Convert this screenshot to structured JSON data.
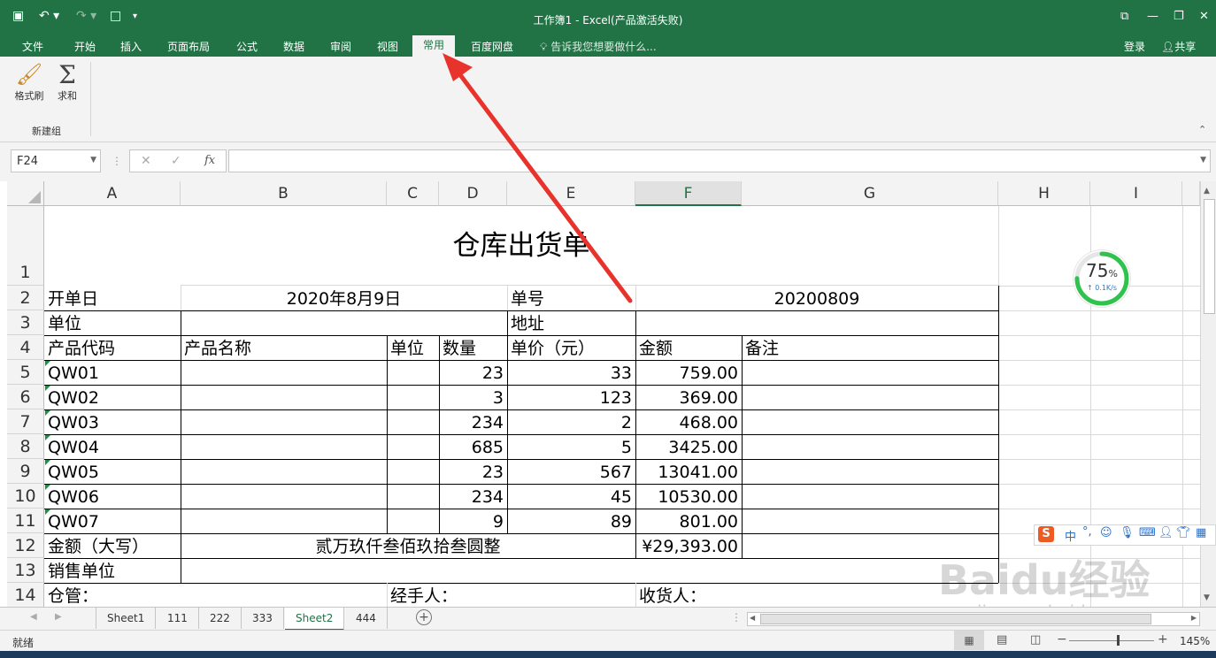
{
  "window": {
    "title": "工作簿1 - Excel(产品激活失败)"
  },
  "ribbon_tabs": [
    "文件",
    "开始",
    "插入",
    "页面布局",
    "公式",
    "数据",
    "审阅",
    "视图",
    "常用",
    "百度网盘"
  ],
  "tell_me": "告诉我您想要做什么...",
  "account": {
    "login": "登录",
    "share": "共享"
  },
  "ribbon_buttons": {
    "format_painter": "格式刷",
    "sum": "求和",
    "group": "新建组"
  },
  "formula": {
    "name_box": "F24",
    "fx": "fx",
    "value": ""
  },
  "columns": [
    "A",
    "B",
    "C",
    "D",
    "E",
    "F",
    "G",
    "H",
    "I"
  ],
  "rows": [
    "1",
    "2",
    "3",
    "4",
    "5",
    "6",
    "7",
    "8",
    "9",
    "10",
    "11",
    "12",
    "13",
    "14"
  ],
  "sheet": {
    "title": "仓库出货单",
    "r2": {
      "a": "开单日",
      "date": "2020年8月9日",
      "e": "单号",
      "no": "20200809"
    },
    "r3": {
      "a": "单位",
      "e": "地址"
    },
    "r4": {
      "a": "产品代码",
      "b": "产品名称",
      "c": "单位",
      "d": "数量",
      "e": "单价（元）",
      "f": "金额",
      "g": "备注"
    },
    "items": [
      {
        "code": "QW01",
        "qty": "23",
        "price": "33",
        "amount": "759.00"
      },
      {
        "code": "QW02",
        "qty": "3",
        "price": "123",
        "amount": "369.00"
      },
      {
        "code": "QW03",
        "qty": "234",
        "price": "2",
        "amount": "468.00"
      },
      {
        "code": "QW04",
        "qty": "685",
        "price": "5",
        "amount": "3425.00"
      },
      {
        "code": "QW05",
        "qty": "23",
        "price": "567",
        "amount": "13041.00"
      },
      {
        "code": "QW06",
        "qty": "234",
        "price": "45",
        "amount": "10530.00"
      },
      {
        "code": "QW07",
        "qty": "9",
        "price": "89",
        "amount": "801.00"
      }
    ],
    "r12": {
      "a": "金额（大写）",
      "words": "贰万玖仟叁佰玖拾叁圆整",
      "total": "¥29,393.00"
    },
    "r13": {
      "a": "销售单位"
    },
    "r14": {
      "a": "仓管：",
      "c": "经手人：",
      "f": "收货人："
    }
  },
  "widget": {
    "percent": "75",
    "percent_sign": "%",
    "speed": "↑ 0.1K/s"
  },
  "ime": {
    "label": "中"
  },
  "watermark": {
    "brand": "Baidu经验",
    "url": "jingyan.baidu.com"
  },
  "sheet_tabs": [
    "Sheet1",
    "111",
    "222",
    "333",
    "Sheet2",
    "444"
  ],
  "active_sheet": "Sheet2",
  "status": {
    "mode": "就绪",
    "zoom": "145%"
  },
  "colors": {
    "excel_green": "#217346",
    "annotation_arrow": "#e8332c"
  }
}
